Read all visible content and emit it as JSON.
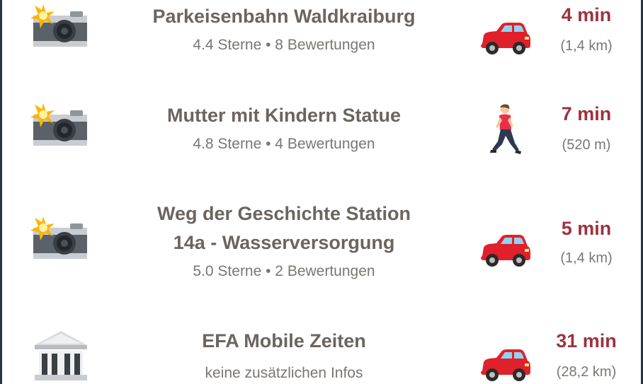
{
  "places": [
    {
      "category_icon": "camera-flash-icon",
      "title_lines": [
        "Parkeisenbahn Waldkraiburg"
      ],
      "subtitle": "4.4 Sterne • 8 Bewertungen",
      "mode_icon": "car-icon",
      "time": "4 min",
      "distance": "(1,4 km)"
    },
    {
      "category_icon": "camera-flash-icon",
      "title_lines": [
        "Mutter mit Kindern Statue"
      ],
      "subtitle": "4.8 Sterne • 4 Bewertungen",
      "mode_icon": "walking-person-icon",
      "time": "7 min",
      "distance": "(520 m)"
    },
    {
      "category_icon": "camera-flash-icon",
      "title_lines": [
        "Weg der Geschichte Station",
        "14a - Wasserversorgung"
      ],
      "subtitle": "5.0 Sterne • 2 Bewertungen",
      "mode_icon": "car-icon",
      "time": "5 min",
      "distance": "(1,4 km)"
    },
    {
      "category_icon": "classical-building-icon",
      "title_lines": [
        "EFA Mobile Zeiten"
      ],
      "subtitle": "keine zusätzlichen Infos",
      "mode_icon": "car-icon",
      "time": "31 min",
      "distance": "(28,2 km)"
    }
  ],
  "colors": {
    "title": "#6b6560",
    "subtitle": "#7a7672",
    "time": "#9c3340",
    "car": "#e0202a",
    "frame": "#2a3447"
  }
}
